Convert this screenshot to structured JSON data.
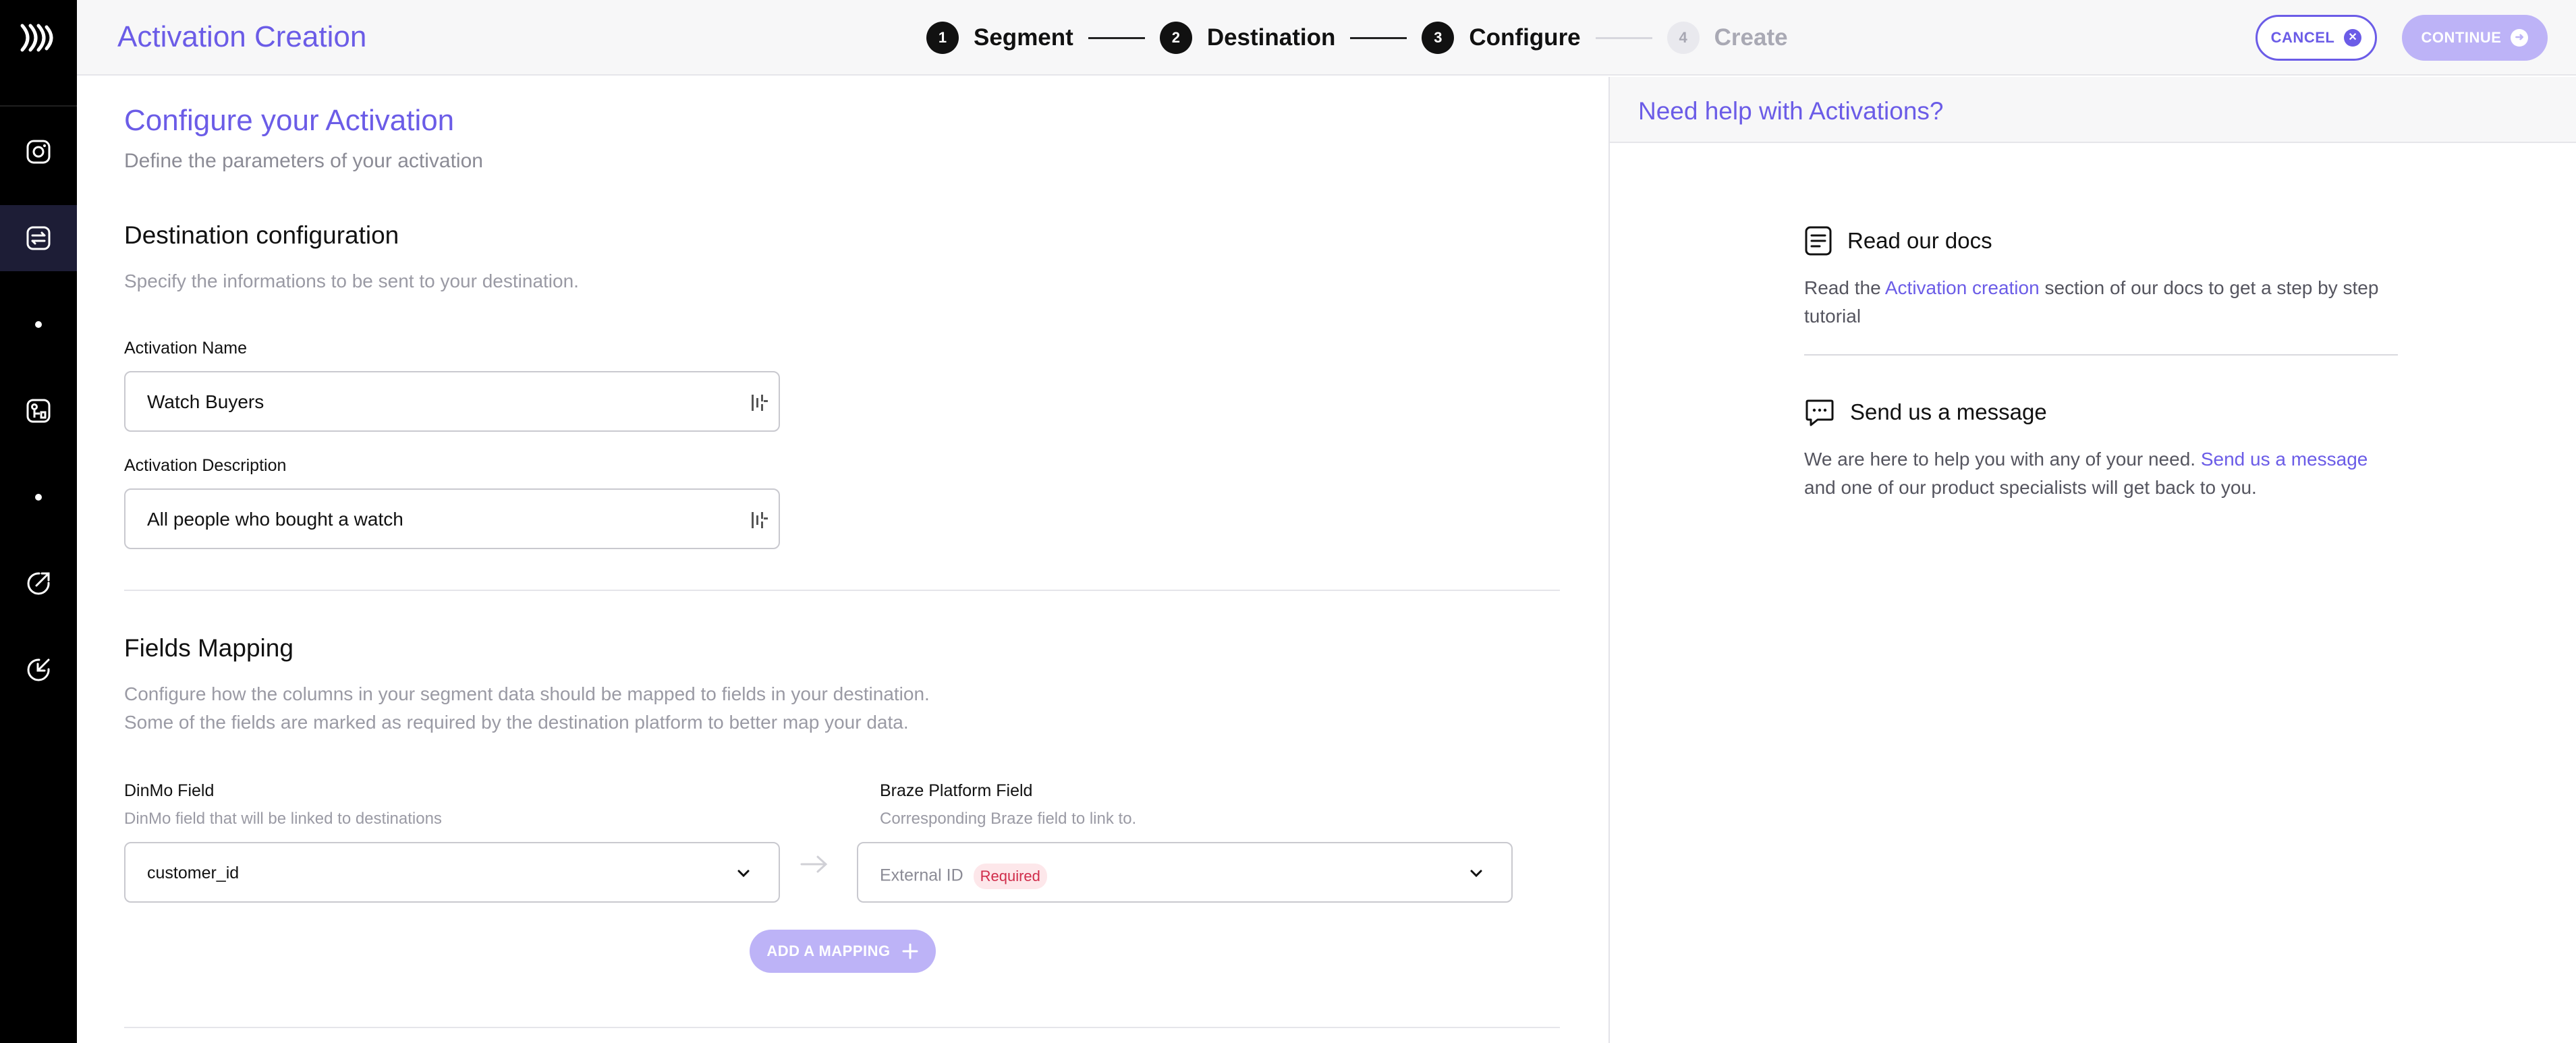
{
  "header": {
    "title": "Activation Creation",
    "steps": [
      {
        "num": "1",
        "label": "Segment"
      },
      {
        "num": "2",
        "label": "Destination"
      },
      {
        "num": "3",
        "label": "Configure"
      },
      {
        "num": "4",
        "label": "Create"
      }
    ],
    "cancel_label": "CANCEL",
    "continue_label": "CONTINUE"
  },
  "main": {
    "title": "Configure your Activation",
    "subtitle": "Define the parameters of your activation",
    "destination": {
      "heading": "Destination configuration",
      "hint": "Specify the informations to be sent to your destination.",
      "name_label": "Activation Name",
      "name_value": "Watch Buyers",
      "desc_label": "Activation Description",
      "desc_value": "All people who bought a watch"
    },
    "mapping": {
      "heading": "Fields Mapping",
      "hint_line1": "Configure how the columns in your segment data should be mapped to fields in your destination.",
      "hint_line2": "Some of the fields are marked as required by the destination platform to better map your data.",
      "left_label": "DinMo Field",
      "left_sub": "DinMo field that will be linked to destinations",
      "right_label": "Braze Platform Field",
      "right_sub": "Corresponding Braze field to link to.",
      "left_value": "customer_id",
      "right_value": "External ID",
      "required_badge": "Required",
      "add_label": "ADD A MAPPING"
    }
  },
  "help": {
    "title": "Need help with Activations?",
    "docs_title": "Read our docs",
    "docs_pre": "Read the ",
    "docs_link": "Activation creation",
    "docs_post": " section of our docs to get a step by step tutorial",
    "msg_title": "Send us a message",
    "msg_pre": "We are here to help you with any of your need. ",
    "msg_link": "Send us a message",
    "msg_post": " and one of our product specialists will get back to you."
  },
  "colors": {
    "accent": "#6b5ce7",
    "accent_light": "#bdb3f7",
    "sidebar": "#000000",
    "required": "#d02c4a"
  },
  "icons": {
    "logo": "dinmo-logo-icon",
    "sidebar": [
      "instagram-like-icon",
      "activation-icon",
      "dot-icon",
      "models-icon",
      "dot-icon",
      "arrow-up-right-circle-icon",
      "arrow-down-left-circle-icon"
    ]
  }
}
